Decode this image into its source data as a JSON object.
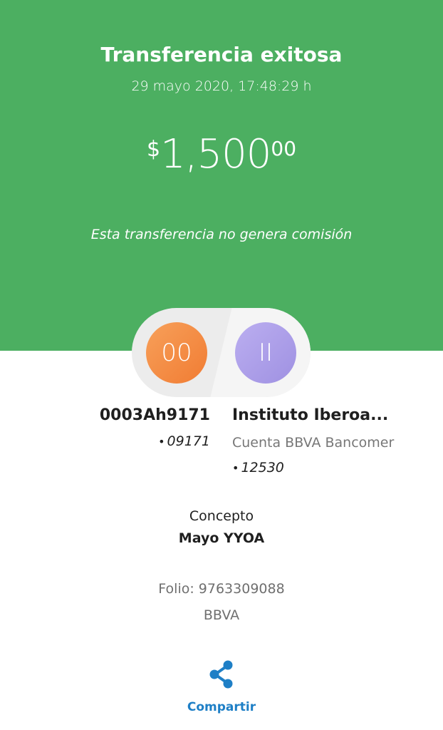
{
  "header": {
    "title": "Transferencia exitosa",
    "datetime": "29 mayo 2020, 17:48:29 h",
    "amount": {
      "currency": "$",
      "integer": "1,500",
      "cents": "00"
    },
    "commission_note": "Esta transferencia no genera comisión",
    "background_color": "#4caf61"
  },
  "origin": {
    "initials": "00",
    "name": "0003Ah9171",
    "account_bullet": "•",
    "account": "09171",
    "avatar_color": "#f17c33"
  },
  "destination": {
    "initials": "II",
    "name": "Instituto Iberoa...",
    "bank": "Cuenta BBVA Bancomer",
    "account_bullet": "•",
    "account": "12530",
    "avatar_color": "#9f91e2"
  },
  "concept": {
    "label": "Concepto",
    "value": "Mayo YYOA"
  },
  "folio": "Folio: 9763309088",
  "bank": "BBVA",
  "share": {
    "label": "Compartir",
    "icon": "share-icon",
    "color": "#1e7fc6"
  }
}
